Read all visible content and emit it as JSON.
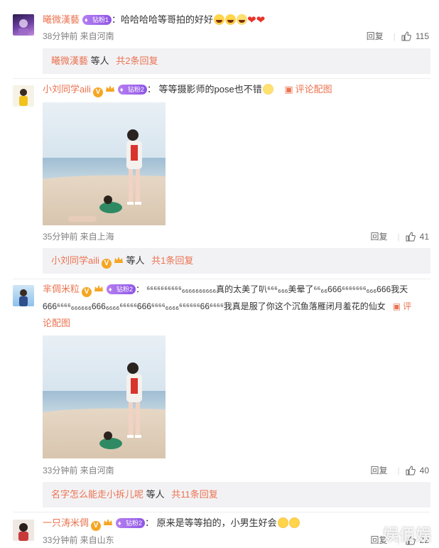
{
  "comments": [
    {
      "user": "曦微漢藝",
      "badge": "钻粉1",
      "text": "：哈哈哈哈等哥拍的好好",
      "time": "38分钟前 来自河南",
      "reply_label": "回复",
      "likes": "115",
      "sub": {
        "name": "曦微漢藝",
        "middle": " 等人 ",
        "more": "共2条回复"
      }
    },
    {
      "user": "小刘同学aili",
      "badge": "钻粉2",
      "text": "： 等等摄影师的pose也不错",
      "pic_link": "评论配图",
      "time": "35分钟前 来自上海",
      "reply_label": "回复",
      "likes": "41",
      "sub": {
        "name": "小刘同学aili",
        "middle": " 等人 ",
        "more": "共1条回复"
      }
    },
    {
      "user": "芈倜米粒",
      "badge": "钻粉2",
      "text_line1": "： ⁶⁶⁶⁶⁶⁶⁶⁶⁶⁶₆₆₆₆₆₆₆₆₆₆真的太美了叭⁶⁶⁶₆₆₆美晕了⁶⁶₆₆666⁶⁶⁶⁶⁶⁶⁶₆₆₆666我天",
      "text_line2": "666⁶⁶⁶⁶₆₆₆₆₆₆666₆₆₆₆⁶⁶⁶⁶⁶666⁶⁶⁶⁶₆₆₆₆⁶⁶⁶⁶⁶⁶66⁶⁶⁶⁶我真是服了你这个沉鱼落雁闭月羞花的仙女",
      "pic_link_a": "评",
      "pic_link_b": "论配图",
      "time": "33分钟前 来自河南",
      "reply_label": "回复",
      "likes": "40",
      "sub": {
        "name": "名字怎么能走小拆儿呢",
        "middle": " 等人 ",
        "more": "共11条回复"
      }
    },
    {
      "user": "一只涛米倜",
      "badge": "钻粉2",
      "text": "： 原来是等等拍的，小男生好会",
      "time": "33分钟前 来自山东",
      "reply_label": "回复",
      "likes": "22"
    }
  ],
  "watermark": "娱佰娱",
  "colors": {
    "accent": "#eb7350",
    "meta": "#808080",
    "subbox": "#f2f2f5"
  }
}
